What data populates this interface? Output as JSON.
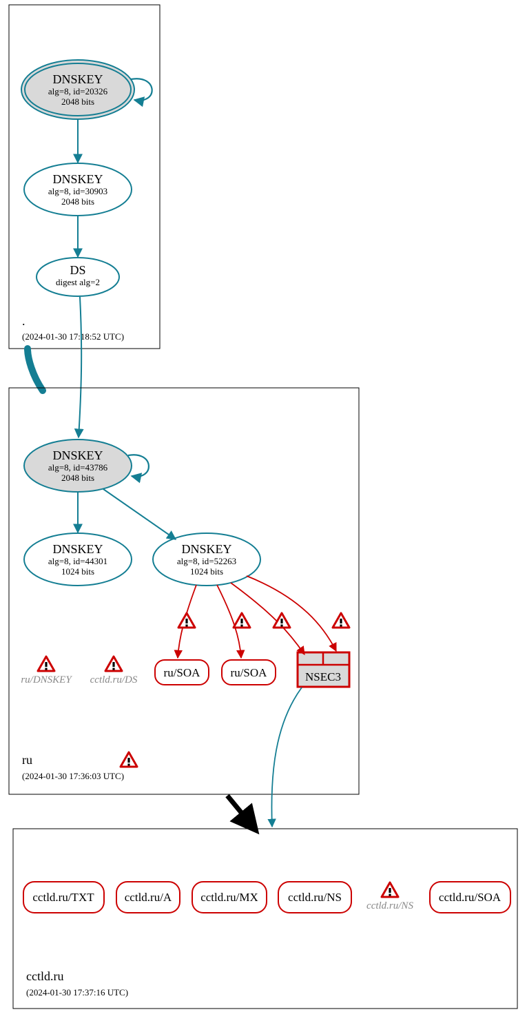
{
  "colors": {
    "teal": "#147e93",
    "red": "#c00",
    "light_gray": "#d9d9d9",
    "white": "#ffffff",
    "black": "#000000"
  },
  "zones": {
    "root": {
      "label": ".",
      "timestamp": "(2024-01-30 17:18:52 UTC)"
    },
    "ru": {
      "label": "ru",
      "timestamp": "(2024-01-30 17:36:03 UTC)"
    },
    "cctld": {
      "label": "cctld.ru",
      "timestamp": "(2024-01-30 17:37:16 UTC)"
    }
  },
  "nodes": {
    "root_ksk": {
      "title": "DNSKEY",
      "line2": "alg=8, id=20326",
      "line3": "2048 bits"
    },
    "root_zsk": {
      "title": "DNSKEY",
      "line2": "alg=8, id=30903",
      "line3": "2048 bits"
    },
    "root_ds": {
      "title": "DS",
      "line2": "digest alg=2"
    },
    "ru_ksk": {
      "title": "DNSKEY",
      "line2": "alg=8, id=43786",
      "line3": "2048 bits"
    },
    "ru_zsk1": {
      "title": "DNSKEY",
      "line2": "alg=8, id=44301",
      "line3": "1024 bits"
    },
    "ru_zsk2": {
      "title": "DNSKEY",
      "line2": "alg=8, id=52263",
      "line3": "1024 bits"
    },
    "ru_soa_a": {
      "label": "ru/SOA"
    },
    "ru_soa_b": {
      "label": "ru/SOA"
    },
    "nsec3": {
      "label": "NSEC3"
    },
    "ru_dnskey_gray": {
      "label": "ru/DNSKEY"
    },
    "cctld_ds_gray": {
      "label": "cctld.ru/DS"
    },
    "cctld_ns_gray": {
      "label": "cctld.ru/NS"
    },
    "cctld_records": [
      {
        "label": "cctld.ru/TXT"
      },
      {
        "label": "cctld.ru/A"
      },
      {
        "label": "cctld.ru/MX"
      },
      {
        "label": "cctld.ru/NS"
      },
      {
        "label": "cctld.ru/SOA"
      }
    ]
  },
  "chart_data": {
    "note": "DNSSEC chain-of-trust diagram with 3 zones (., ru, cctld.ru). Arrows teal=secure, red=bogus, black=insecure delegation. Warning triangles indicate DNSSEC errors on ru zone records and cctld.ru DS/NS."
  }
}
